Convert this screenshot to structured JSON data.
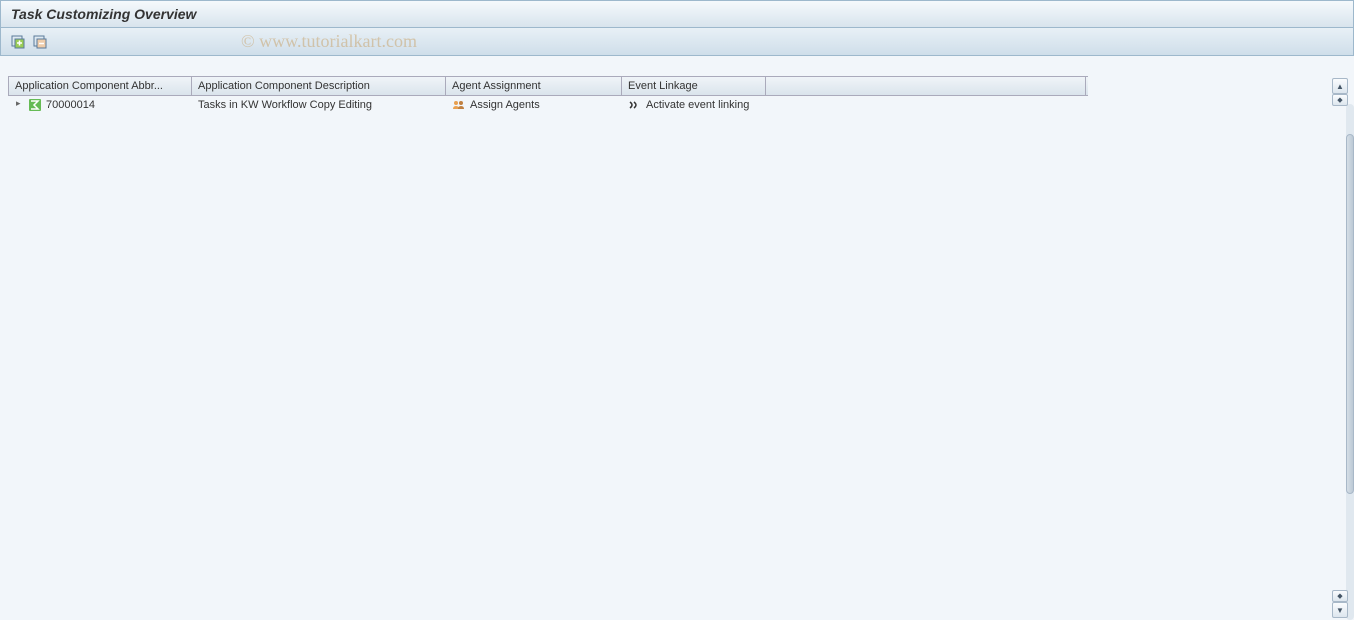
{
  "title": "Task Customizing Overview",
  "watermark": "© www.tutorialkart.com",
  "columns": {
    "abbr": "Application Component Abbr...",
    "desc": "Application Component Description",
    "agent": "Agent Assignment",
    "event": "Event Linkage",
    "last": ""
  },
  "rows": [
    {
      "abbr": "70000014",
      "desc": "Tasks in KW Workflow Copy Editing",
      "agent": "Assign Agents",
      "event": "Activate event linking"
    }
  ]
}
